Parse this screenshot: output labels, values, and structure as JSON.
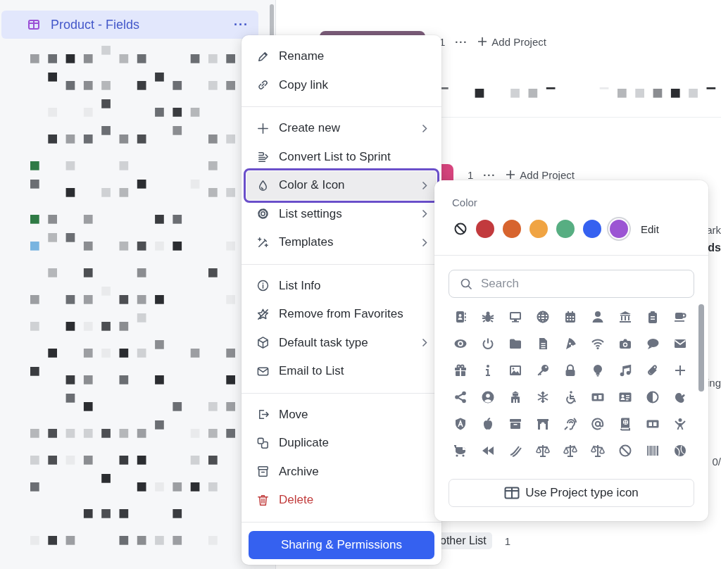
{
  "sidebar": {
    "selected_item": {
      "label": "Product - Fields",
      "selected": true,
      "more": "···"
    }
  },
  "main": {
    "groups": [
      {
        "color": "#7b5c79",
        "count": "1",
        "more": "···",
        "add_label": "Add Project"
      },
      {
        "color": "#d8457e",
        "count": "1",
        "more": "···",
        "add_label": "Add Project"
      }
    ],
    "edge_texts": [
      "ark",
      "ds",
      "ing",
      "0/"
    ],
    "footer_chip": {
      "label": "other List",
      "count": "1"
    }
  },
  "context_menu": {
    "sections": [
      [
        {
          "label": "Rename",
          "submenu": false,
          "highlighted": false,
          "kind": "normal"
        },
        {
          "label": "Copy link",
          "submenu": false,
          "highlighted": false,
          "kind": "normal"
        }
      ],
      [
        {
          "label": "Create new",
          "submenu": true,
          "highlighted": false,
          "kind": "normal"
        },
        {
          "label": "Convert List to Sprint",
          "submenu": false,
          "highlighted": false,
          "kind": "normal"
        },
        {
          "label": "Color & Icon",
          "submenu": true,
          "highlighted": true,
          "kind": "normal"
        },
        {
          "label": "List settings",
          "submenu": true,
          "highlighted": false,
          "kind": "normal"
        },
        {
          "label": "Templates",
          "submenu": true,
          "highlighted": false,
          "kind": "normal"
        }
      ],
      [
        {
          "label": "List Info",
          "submenu": false,
          "highlighted": false,
          "kind": "normal"
        },
        {
          "label": "Remove from Favorites",
          "submenu": false,
          "highlighted": false,
          "kind": "normal"
        },
        {
          "label": "Default task type",
          "submenu": true,
          "highlighted": false,
          "kind": "normal"
        },
        {
          "label": "Email to List",
          "submenu": false,
          "highlighted": false,
          "kind": "normal"
        }
      ],
      [
        {
          "label": "Move",
          "submenu": false,
          "highlighted": false,
          "kind": "normal"
        },
        {
          "label": "Duplicate",
          "submenu": false,
          "highlighted": false,
          "kind": "normal"
        },
        {
          "label": "Archive",
          "submenu": false,
          "highlighted": false,
          "kind": "normal"
        },
        {
          "label": "Delete",
          "submenu": false,
          "highlighted": false,
          "kind": "danger"
        }
      ]
    ],
    "primary_button": "Sharing & Permissions"
  },
  "color_panel": {
    "title": "Color",
    "swatches": [
      {
        "color": "#c23a3d",
        "selected": false
      },
      {
        "color": "#d7642e",
        "selected": false
      },
      {
        "color": "#f0a443",
        "selected": false
      },
      {
        "color": "#57ae82",
        "selected": false
      },
      {
        "color": "#3561f0",
        "selected": false
      },
      {
        "color": "#9b55d3",
        "selected": true
      }
    ],
    "edit_label": "Edit",
    "search": {
      "placeholder": "Search"
    },
    "footer_button": "Use Project type icon"
  }
}
